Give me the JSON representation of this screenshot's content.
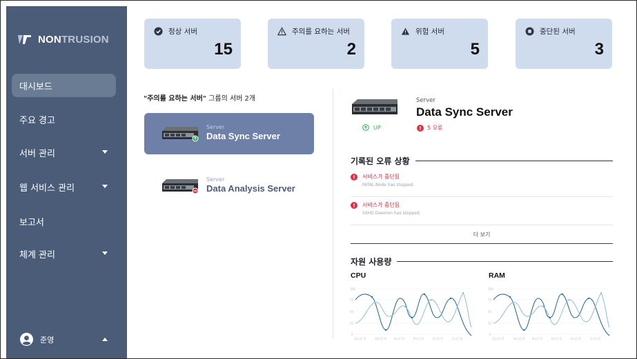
{
  "sidebar": {
    "brand_a": "NON",
    "brand_b": "TRUSION",
    "items": [
      {
        "label": "대시보드"
      },
      {
        "label": "주요 경고"
      },
      {
        "label": "서버 관리"
      },
      {
        "label": "웹 서비스 관리"
      },
      {
        "label": "보고서"
      },
      {
        "label": "체계 관리"
      }
    ],
    "user": "준영"
  },
  "stats": [
    {
      "label": "정상 서버",
      "value": "15",
      "icon": "check-circle-icon"
    },
    {
      "label": "주의를 요하는 서버",
      "value": "2",
      "icon": "warning-outline-icon"
    },
    {
      "label": "위험 서버",
      "value": "5",
      "icon": "warning-filled-icon"
    },
    {
      "label": "중단된 서버",
      "value": "3",
      "icon": "stop-circle-icon"
    }
  ],
  "list": {
    "group_name": "\"주의를 요하는 서버\"",
    "group_suffix": " 그룹의 서버 2개",
    "servers": [
      {
        "sub": "Server",
        "name": "Data Sync Server"
      },
      {
        "sub": "Server",
        "name": "Data Analysis Server"
      }
    ]
  },
  "detail": {
    "sub": "Server",
    "name": "Data Sync Server",
    "status": "UP",
    "errors_badge": "5 오류",
    "errors_title": "기록된 오류 상황",
    "errors": [
      {
        "title": "서비스가 중단됨",
        "msg": "FATAL:Node has stopped."
      },
      {
        "title": "서비스가 중단됨",
        "msg": "SSHD Daemon has stopped."
      }
    ],
    "more": "더 보기",
    "usage_title": "자원 사용량",
    "cpu_label": "CPU",
    "ram_label": "RAM"
  },
  "colors": {
    "sidebar": "#4a5c77",
    "card": "#cfdced",
    "selected": "#6e7fa8",
    "ok": "#2bb24c",
    "error": "#d83445",
    "series_dark": "#2f6e9a",
    "series_light": "#8fbcd6"
  }
}
